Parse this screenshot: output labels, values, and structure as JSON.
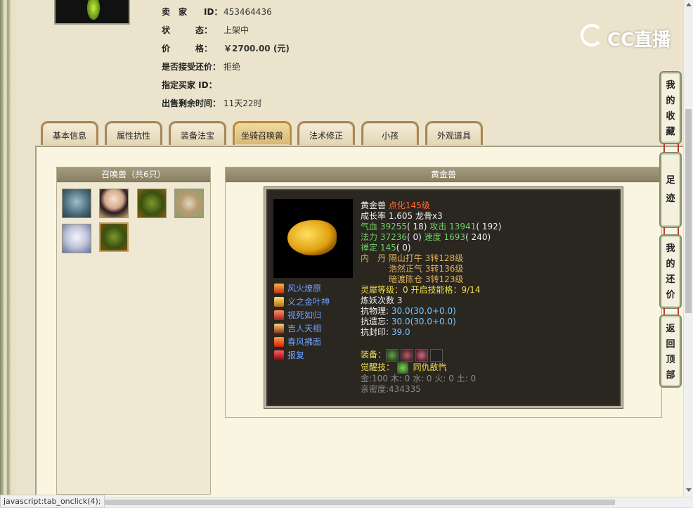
{
  "seller": {
    "rows": [
      {
        "label": "卖　家　　ID：",
        "value": "453464436"
      },
      {
        "label": "状　　　态：",
        "value": "上架中"
      },
      {
        "label": "价　　　格：",
        "value": "￥2700.00 (元)"
      },
      {
        "label": "是否接受还价：",
        "value": "拒绝"
      },
      {
        "label": "指定买家 ID：",
        "value": ""
      },
      {
        "label": "出售剩余时间：",
        "value": "11天22时"
      }
    ]
  },
  "logo": {
    "text": "CC直播"
  },
  "tabs": [
    "基本信息",
    "属性抗性",
    "装备法宝",
    "坐骑召唤兽",
    "法术修正",
    "小孩",
    "外观道具"
  ],
  "active_tab": "坐骑召唤兽",
  "left_panel": {
    "title": "召唤兽（共6只）"
  },
  "right_panel": {
    "title": "黄金兽"
  },
  "pet": {
    "name": "黄金兽",
    "tag": "点化145级",
    "growth": "成长率 1.605 龙骨x3",
    "hp_label": "气血",
    "hp": "39255",
    "hp_extra": "( 18)",
    "atk_label": "攻击",
    "atk": "13941",
    "atk_extra": "( 192)",
    "mp_label": "法力",
    "mp": "37236",
    "mp_extra": "( 0)",
    "spd_label": "速度",
    "spd": "1693",
    "spd_extra": "( 240)",
    "cal_label": "禅定",
    "cal": "145",
    "cal_extra": "( 0)",
    "dan_label": "内　丹",
    "dan": [
      "隔山打牛 3转128级",
      "浩然正气 3转136级",
      "暗渡陈仓 3转123级"
    ],
    "lingxi_label": "灵犀等级：",
    "lingxi": "0",
    "kaiqi_label": "开启技能格：",
    "kaiqi": "9/14",
    "lianyao": "炼妖次数 3",
    "resist_phys_label": "抗物理:",
    "resist_phys": "30.0(30.0+0.0)",
    "resist_forget_label": "抗遗忘:",
    "resist_forget": "30.0(30.0+0.0)",
    "resist_seal_label": "抗封印:",
    "resist_seal": "39.0",
    "equip_label": "装备：",
    "awake_label": "觉醒技：",
    "awake": "同仇敌忾",
    "elements": "金:100 木: 0 水: 0 火: 0 土: 0",
    "intimacy": "亲密度:434335",
    "skills": [
      "风火燎原",
      "义之金叶神",
      "视死如归",
      "吉人天相",
      "春风拂面",
      "报复"
    ]
  },
  "side_buttons": [
    "我的收藏",
    "足迹",
    "我的还价",
    "返回顶部"
  ],
  "status_text": "javascript:tab_onclick(4);"
}
